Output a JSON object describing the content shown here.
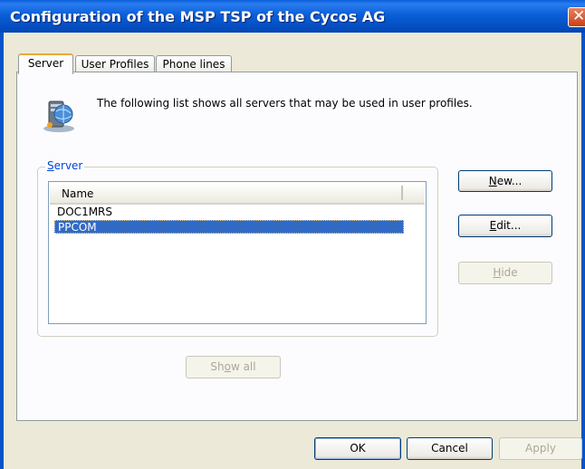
{
  "window": {
    "title": "Configuration of the MSP TSP of the Cycos AG",
    "close_glyph": "✕"
  },
  "tabs": [
    {
      "label": "Server",
      "active": true
    },
    {
      "label": "User Profiles",
      "active": false
    },
    {
      "label": "Phone lines",
      "active": false
    }
  ],
  "server_tab": {
    "icon": "server-network-icon",
    "intro_text": "The following list shows all servers that may be used in user profiles.",
    "group_label": {
      "accel": "S",
      "rest": "erver"
    },
    "list": {
      "column_header": "Name",
      "rows": [
        {
          "name": "DOC1MRS",
          "selected": false
        },
        {
          "name": "PPCOM",
          "selected": true
        }
      ]
    },
    "buttons": {
      "new": {
        "accel": "N",
        "rest": "ew...",
        "enabled": true
      },
      "edit": {
        "accel": "E",
        "rest": "dit...",
        "enabled": true
      },
      "hide": {
        "accel": "H",
        "rest": "ide",
        "enabled": false
      },
      "show_all": {
        "pre": "Sh",
        "accel": "o",
        "rest": "w all",
        "enabled": false
      }
    }
  },
  "dialog_buttons": {
    "ok": "OK",
    "cancel": "Cancel",
    "apply": "Apply"
  },
  "colors": {
    "title_bar": "#0554c9",
    "selection": "#316ac5",
    "group_label": "#0046d5"
  }
}
